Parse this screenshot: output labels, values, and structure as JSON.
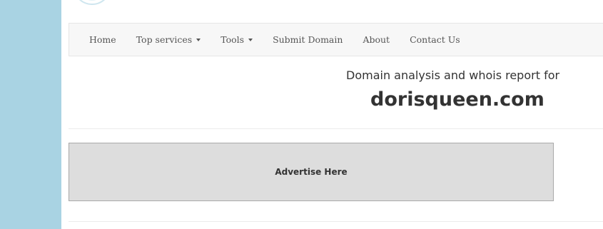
{
  "brand": {
    "logo_text": "dorisqueen.com",
    "accent": "#a9d3e3"
  },
  "nav": {
    "items": [
      {
        "label": "Home",
        "dropdown": false
      },
      {
        "label": "Top services",
        "dropdown": true
      },
      {
        "label": "Tools",
        "dropdown": true
      },
      {
        "label": "Submit Domain",
        "dropdown": false
      },
      {
        "label": "About",
        "dropdown": false
      },
      {
        "label": "Contact Us",
        "dropdown": false
      }
    ]
  },
  "heading": {
    "subtitle": "Domain analysis and whois report for",
    "domain": "dorisqueen.com"
  },
  "ad": {
    "label": "Advertise Here"
  }
}
